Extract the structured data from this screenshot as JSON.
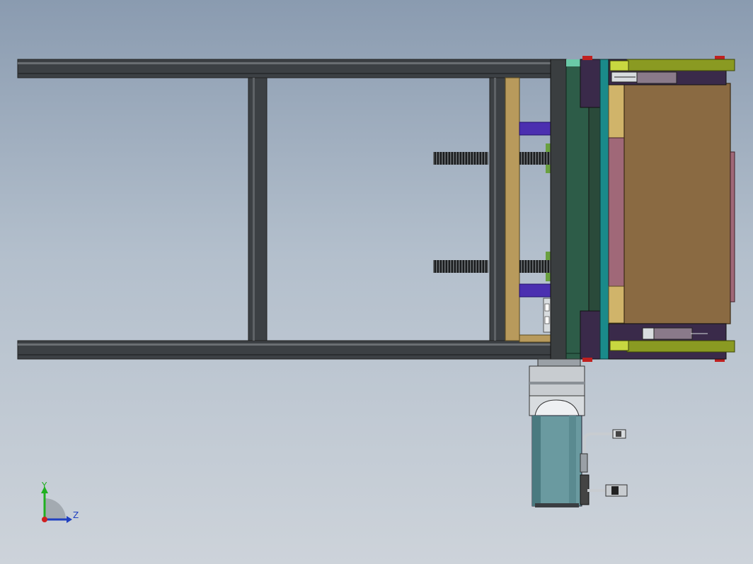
{
  "colors": {
    "background_top": "#8a9bb0",
    "background_bottom": "#cdd3da",
    "frame_rail": "#404448",
    "tan_plate": "#b89a5c",
    "purple_block": "#4b2fb0",
    "dark_green_plate": "#2d5c48",
    "teal_plate": "#1a8a8a",
    "olive_bracket": "#8a9a22",
    "brown_box": "#8a6a42",
    "pink_strip": "#a06878",
    "motor_body": "#6a9aa0",
    "reducer": "#c8ccd0",
    "red_cap": "#c02020"
  },
  "triad": {
    "y_label": "Y",
    "z_label": "Z",
    "y_color": "#20b020",
    "z_color": "#2040c0",
    "origin_color": "#d02020"
  }
}
